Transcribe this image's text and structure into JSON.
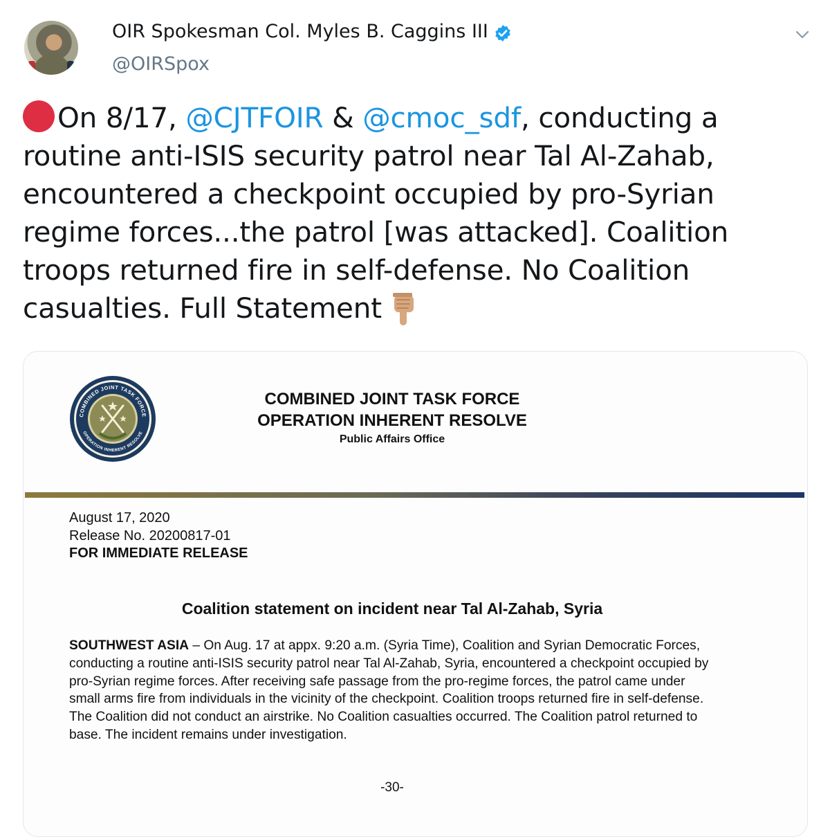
{
  "tweet": {
    "display_name": "OIR Spokesman Col. Myles B. Caggins III",
    "handle": "@OIRSpox",
    "text_part1": "On 8/17, ",
    "mention1": "@CJTFOIR",
    "text_part2": " & ",
    "mention2": "@cmoc_sdf",
    "text_part3": ", conducting a routine anti-ISIS security patrol near Tal Al-Zahab, encountered a checkpoint occupied by pro-Syrian regime forces...the patrol [was attacked]. Coalition troops returned fire in self-defense. No Coalition casualties. Full Statement",
    "icons": {
      "avatar": "profile-photo",
      "verified": "verified-badge-icon",
      "menu": "chevron-down-icon",
      "emoji1": "red-circle-icon",
      "emoji2": "point-down-icon"
    },
    "colors": {
      "mention": "#1b95e0",
      "handle": "#657786",
      "verified": "#1da1f2",
      "red_dot": "#dd2e44"
    }
  },
  "document": {
    "seal_text_top": "COMBINED JOINT TASK FORCE",
    "seal_text_bottom": "OPERATION INHERENT RESOLVE",
    "title_line1": "COMBINED JOINT TASK FORCE",
    "title_line2": "OPERATION INHERENT RESOLVE",
    "subtitle": "Public Affairs Office",
    "date": "August 17, 2020",
    "release_no": "Release No. 20200817-01",
    "release_type": "FOR IMMEDIATE RELEASE",
    "headline": "Coalition statement on incident near Tal Al-Zahab, Syria",
    "body_lead": "SOUTHWEST ASIA",
    "body_text": " – On Aug. 17 at appx. 9:20 a.m. (Syria Time), Coalition and Syrian Democratic Forces, conducting a routine anti-ISIS security patrol near Tal Al-Zahab, Syria, encountered a checkpoint occupied by pro-Syrian regime forces. After receiving safe passage from the pro-regime forces, the patrol came under small arms fire from individuals in the vicinity of the checkpoint. Coalition troops returned fire in self-defense. The Coalition did not conduct an airstrike. No Coalition casualties occurred. The Coalition patrol returned to base. The incident remains under investigation.",
    "end_mark": "-30-"
  }
}
